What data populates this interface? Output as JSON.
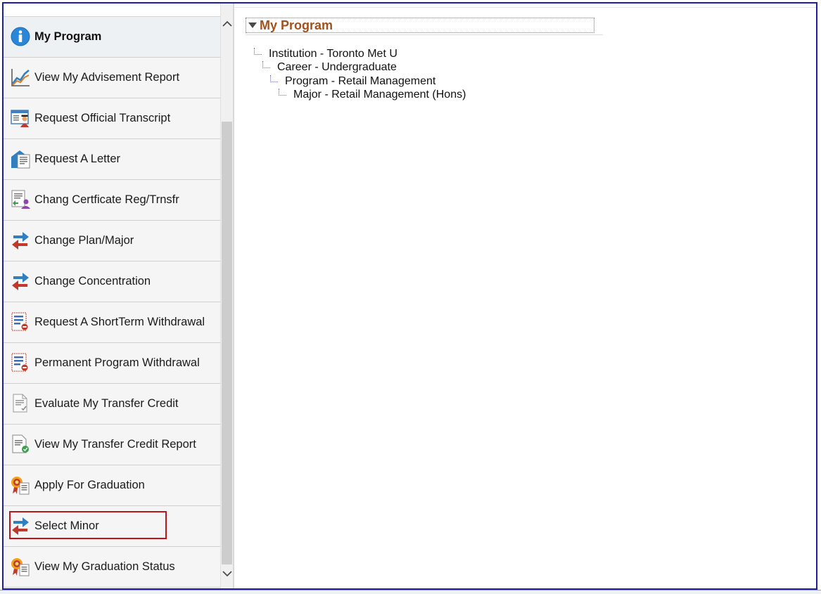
{
  "sidebar": {
    "items": [
      {
        "label": "My Program",
        "icon": "info-icon",
        "active": true
      },
      {
        "label": "View My Advisement Report",
        "icon": "line-chart-icon"
      },
      {
        "label": "Request Official Transcript",
        "icon": "transcript-icon"
      },
      {
        "label": "Request A Letter",
        "icon": "letter-icon"
      },
      {
        "label": "Chang Certficate Reg/Trnsfr",
        "icon": "certificate-transfer-icon"
      },
      {
        "label": "Change Plan/Major",
        "icon": "swap-arrows-icon"
      },
      {
        "label": "Change Concentration",
        "icon": "swap-arrows-icon"
      },
      {
        "label": "Request A ShortTerm Withdrawal",
        "icon": "withdrawal-form-icon"
      },
      {
        "label": "Permanent Program Withdrawal",
        "icon": "withdrawal-form-icon"
      },
      {
        "label": "Evaluate My Transfer Credit",
        "icon": "document-check-icon"
      },
      {
        "label": "View My Transfer Credit Report",
        "icon": "report-approved-icon"
      },
      {
        "label": "Apply For Graduation",
        "icon": "graduation-award-icon"
      },
      {
        "label": "Select Minor",
        "icon": "swap-arrows-icon",
        "highlighted": true
      },
      {
        "label": "View My Graduation Status",
        "icon": "graduation-award-icon"
      }
    ]
  },
  "main": {
    "section_title": "My Program",
    "tree": [
      {
        "label": "Institution - Toronto Met U",
        "level": 0
      },
      {
        "label": "Career - Undergraduate",
        "level": 1
      },
      {
        "label": "Program - Retail Management",
        "level": 2
      },
      {
        "label": "Major - Retail Management (Hons)",
        "level": 3
      }
    ]
  },
  "colors": {
    "frame_border": "#1f1f9e",
    "section_title": "#a0521e",
    "highlight_box": "#c0141c",
    "arrow_blue": "#2f7fc1",
    "arrow_red": "#c0392b"
  }
}
